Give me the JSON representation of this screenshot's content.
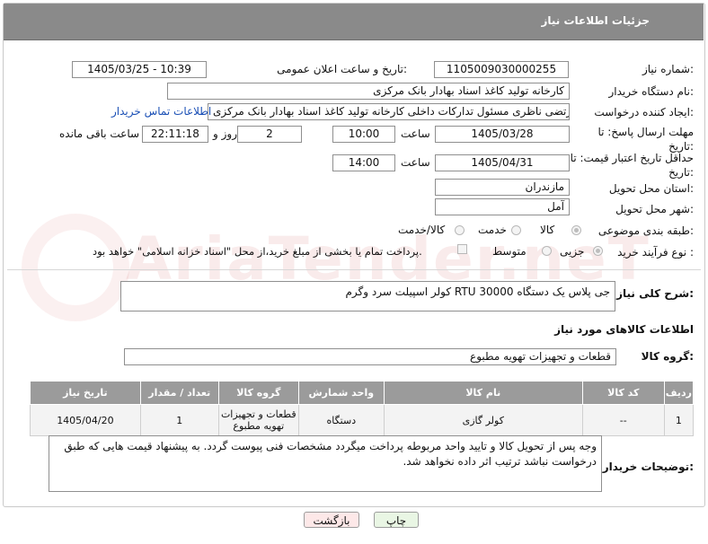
{
  "header": {
    "title": "جزئیات اطلاعات نیاز"
  },
  "form": {
    "need_number": {
      "label": "شماره نیاز:",
      "value": "1105009030000255"
    },
    "announce": {
      "label": "تاریخ و ساعت اعلان عمومی:",
      "value": "1405/03/25 - 10:39"
    },
    "buyer_org": {
      "label": "نام دستگاه خریدار:",
      "value": "کارخانه تولید کاغذ اسناد بهادار بانک مرکزی"
    },
    "requester": {
      "label": "ایجاد کننده درخواست:",
      "value": "مرتضی ناظری مسئول تدارکات داخلی کارخانه تولید کاغذ اسناد بهادار بانک مرکزی",
      "contact_link": "اطلاعات تماس خریدار"
    },
    "reply_deadline": {
      "label": "مهلت ارسال پاسخ: تا تاریخ:",
      "date": "1405/03/28",
      "time_label": "ساعت",
      "time": "10:00",
      "days": "2",
      "days_label": "روز و",
      "remaining": "22:11:18",
      "remaining_label": "ساعت باقی مانده"
    },
    "price_validity": {
      "label": "حداقل تاریخ اعتبار قیمت: تا تاریخ:",
      "date": "1405/04/31",
      "time_label": "ساعت",
      "time": "14:00"
    },
    "province": {
      "label": "استان محل تحویل:",
      "value": "مازندران"
    },
    "city": {
      "label": "شهر محل تحویل:",
      "value": "آمل"
    },
    "category": {
      "label": "طبقه بندی موضوعی:",
      "options": [
        "کالا",
        "خدمت",
        "کالا/خدمت"
      ],
      "selected": "کالا"
    },
    "process": {
      "label": "نوع فرآیند خرید :",
      "options": [
        "جزیی",
        "متوسط"
      ],
      "selected": "جزیی",
      "payment_note": "پرداخت تمام یا بخشی از مبلغ خرید،از محل \"اسناد خزانه اسلامی\" خواهد بود."
    }
  },
  "description": {
    "label": "شرح کلی نیاز:",
    "value": "کولر اسپیلت سرد وگرم RTU 30000  جی پلاس یک دستگاه"
  },
  "goods_section": {
    "title": "اطلاعات کالاهای مورد نیاز"
  },
  "goods_group": {
    "label": "گروه کالا:",
    "value": "قطعات و تجهیزات تهویه مطبوع"
  },
  "table": {
    "headers": [
      "ردیف",
      "کد کالا",
      "نام کالا",
      "واحد شمارش",
      "گروه کالا",
      "تعداد / مقدار",
      "تاریخ نیاز"
    ],
    "rows": [
      [
        "1",
        "--",
        "کولر گازی",
        "دستگاه",
        "قطعات و تجهیزات تهویه مطبوع",
        "1",
        "1405/04/20"
      ]
    ]
  },
  "buyer_notes": {
    "label": "توضیحات خریدار:",
    "value": "وجه پس از تحویل کالا و تایید واحد مربوطه پرداخت میگردد مشخصات فنی پیوست گردد. به پیشنهاد قیمت هایی که طبق درخواست نباشد ترتیب اثر داده نخواهد شد."
  },
  "buttons": {
    "print": "چاپ",
    "back": "بازگشت"
  },
  "watermark": "AriaTender.neT",
  "colors": {
    "header_bg": "#8a8a8a",
    "table_header_bg": "#9b9b9b",
    "back_button_bg": "#fde8e8",
    "print_button_bg": "#e9f6e4",
    "link": "#1a4fb5"
  }
}
